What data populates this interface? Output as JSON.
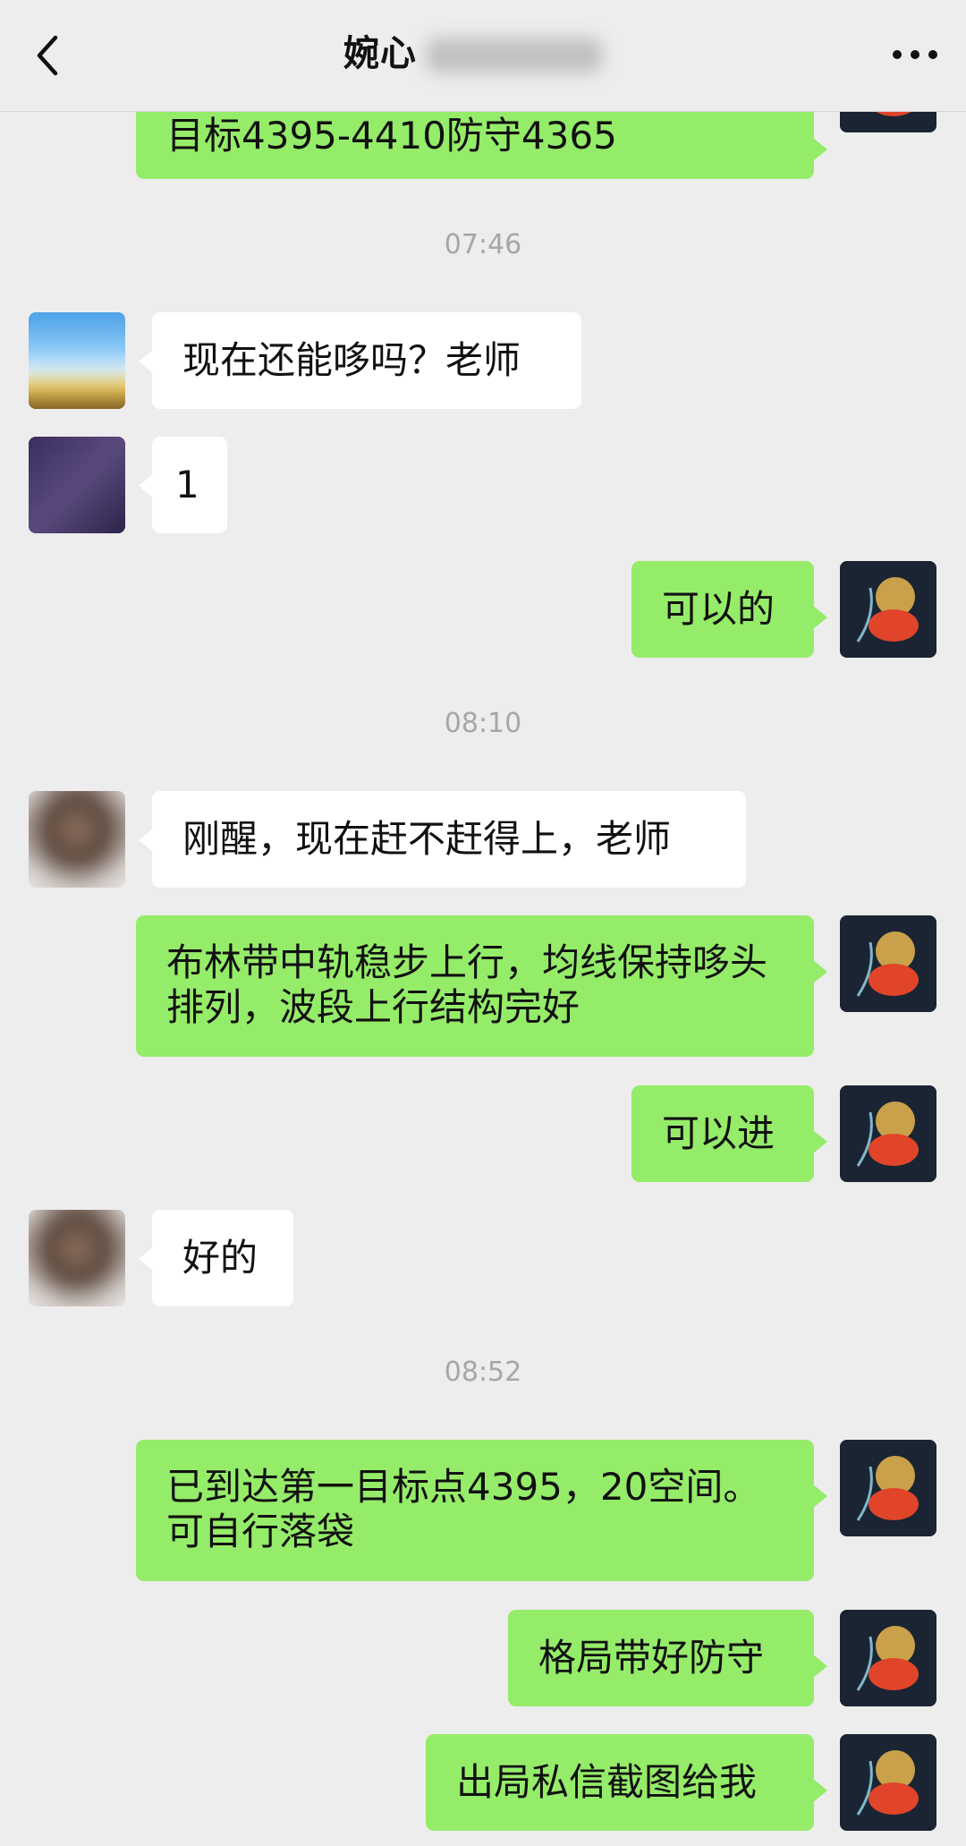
{
  "header": {
    "title": "婉心"
  },
  "messages": {
    "m0": "目标4395-4410防守4365",
    "t1": "07:46",
    "m1": "现在还能哆吗？老师",
    "m2": "1",
    "m3": "可以的",
    "t2": "08:10",
    "m4": "刚醒，现在赶不赶得上，老师",
    "m5": "布林带中轨稳步上行，均线保持哆头排列，波段上行结构完好",
    "m6": "可以进",
    "m7": "好的",
    "t3": "08:52",
    "m8": "已到达第一目标点4395，20空间。可自行落袋",
    "m9": "格局带好防守",
    "m10": "出局私信截图给我"
  },
  "icons": {
    "back": "chevron-left-icon",
    "more": "more-dots-icon"
  },
  "colors": {
    "sent_bubble": "#95ec69",
    "received_bubble": "#ffffff",
    "background": "#ededed",
    "timestamp": "#a6a6a6"
  }
}
